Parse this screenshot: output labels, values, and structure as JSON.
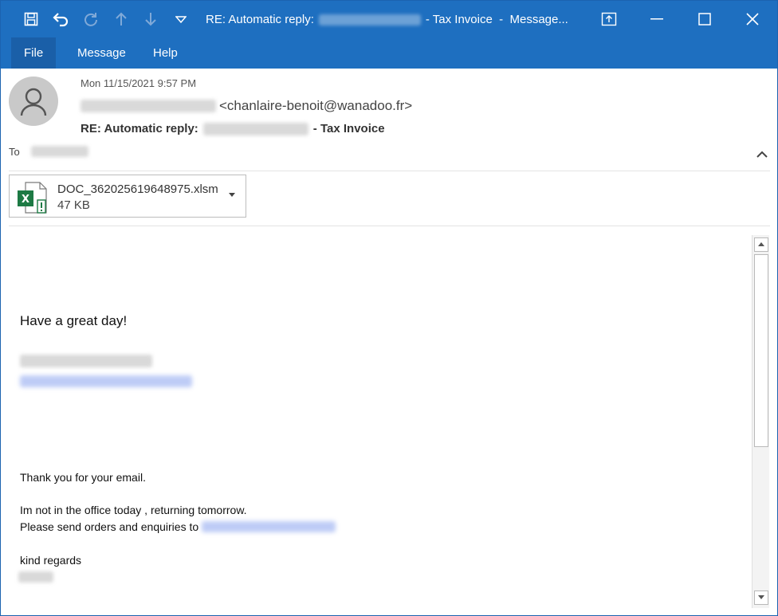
{
  "window": {
    "title_prefix": "RE: Automatic reply:",
    "title_suffix": "- Tax Invoice  -  Message..."
  },
  "ribbon": {
    "tabs": [
      {
        "label": "File"
      },
      {
        "label": "Message"
      },
      {
        "label": "Help"
      }
    ]
  },
  "message": {
    "date": "Mon 11/15/2021 9:57 PM",
    "from_email": "<chanlaire-benoit@wanadoo.fr>",
    "subject_prefix": "RE: Automatic reply:",
    "subject_suffix": "- Tax Invoice",
    "to_label": "To"
  },
  "attachment": {
    "name": "DOC_362025619648975.xlsm",
    "size": "47 KB",
    "icon": "excel-macro-icon"
  },
  "body": {
    "greeting": "Have a great day!",
    "line1": "Thank you for your email.",
    "line2": "Im not in the office today , returning tomorrow.",
    "line3": "Please send orders and enquiries to",
    "line4": "kind regards"
  },
  "colors": {
    "titlebar": "#1e6fc0",
    "excel_green": "#1d7a44"
  }
}
